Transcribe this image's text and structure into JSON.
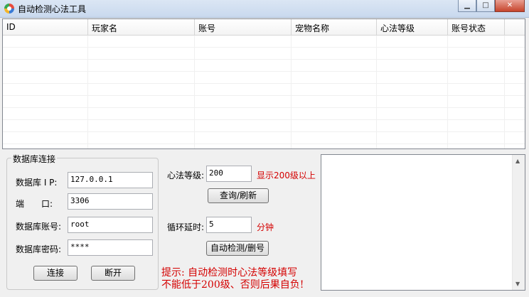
{
  "window": {
    "title": "自动检测心法工具",
    "minimize_icon": "minimize-icon",
    "maximize_icon": "maximize-icon",
    "close_icon": "close-icon"
  },
  "table": {
    "columns": [
      "ID",
      "玩家名",
      "账号",
      "宠物名称",
      "心法等级",
      "账号状态"
    ],
    "rows": []
  },
  "db_group": {
    "title": "数据库连接",
    "ip_label": "数据库 I P:",
    "ip_value": "127.0.0.1",
    "port_label": "端　　口:",
    "port_value": "3306",
    "account_label": "数据库账号:",
    "account_value": "root",
    "password_label": "数据库密码:",
    "password_value": "****",
    "connect_label": "连接",
    "disconnect_label": "断开"
  },
  "controls": {
    "level_label": "心法等级:",
    "level_value": "200",
    "level_note": "显示200级以上",
    "query_label": "查询/刷新",
    "loop_label": "循环延时:",
    "loop_value": "5",
    "loop_unit": "分钟",
    "auto_label": "自动检测/删号"
  },
  "hint": {
    "line1": "提示: 自动检测时心法等级填写",
    "line2": "不能低于200级、否则后果自负!"
  }
}
